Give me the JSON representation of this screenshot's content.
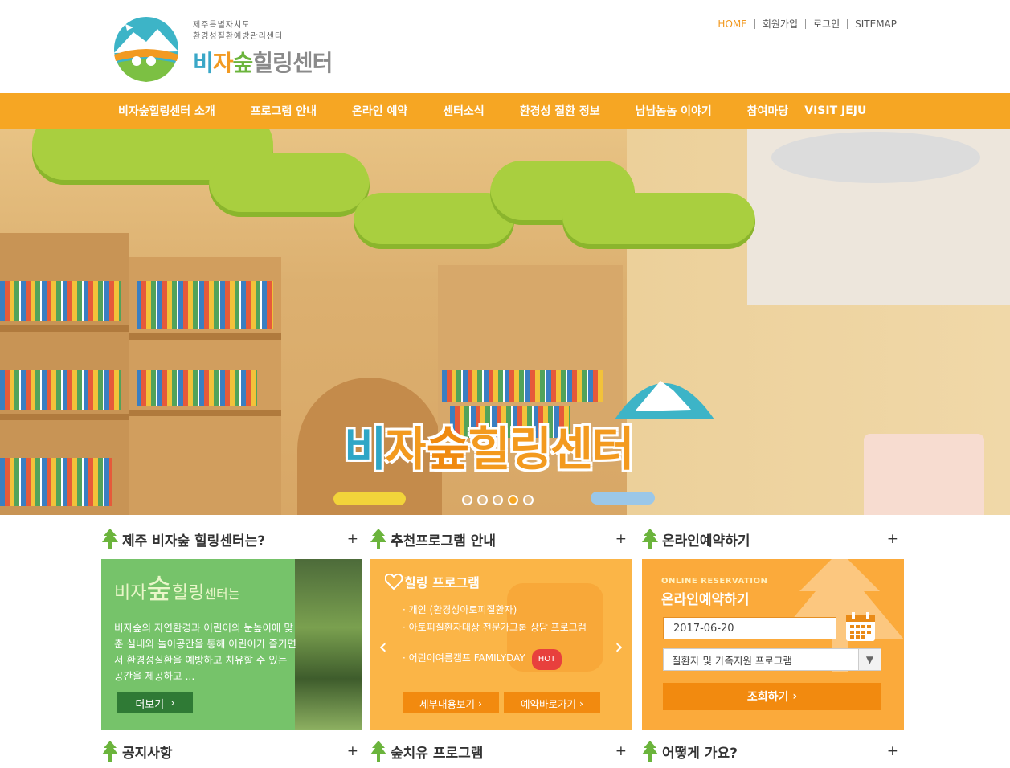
{
  "header": {
    "logo_sub1": "제주특별자치도",
    "logo_sub2": "환경성질환예방관리센터",
    "logo_main_a": "비",
    "logo_main_b": "자",
    "logo_main_c": "숲",
    "logo_main_d": "힐링센터",
    "util": [
      "HOME",
      "회원가입",
      "로그인",
      "SITEMAP"
    ]
  },
  "gnb": [
    "비자숲힐링센터 소개",
    "프로그램 안내",
    "온라인 예약",
    "센터소식",
    "환경성 질환 정보",
    "남남놈놈 이야기",
    "참여마당",
    "VISIT JEJU"
  ],
  "hero": {
    "title_a": "비",
    "title_b": "자",
    "title_c": "숲",
    "title_d": "힐링센터",
    "slide_count": 5,
    "active_slide": 4
  },
  "sections": {
    "about": {
      "title": "제주 비자숲 힐링센터는?",
      "plus": "+"
    },
    "programs": {
      "title": "추천프로그램 안내",
      "plus": "+"
    },
    "reserve": {
      "title": "온라인예약하기",
      "plus": "+"
    },
    "notice": {
      "title": "공지사항",
      "plus": "+"
    },
    "forest": {
      "title": "숲치유 프로그램",
      "plus": "+"
    },
    "howto": {
      "title": "어떻게 가요?",
      "plus": "+"
    }
  },
  "about_box": {
    "title_a": "비자",
    "title_b": "숲",
    "title_c": "힐링",
    "title_d": "센터는",
    "body": "비자숲의 자연환경과 어린이의 눈높이에 맞춘 실내외 놀이공간을 통해 어린이가 즐기면서 환경성질환을 예방하고 치유할 수 있는 공간을 제공하고 ...",
    "more": "더보기"
  },
  "program_box": {
    "title": "힐링 프로그램",
    "items": [
      "· 개인 (환경성아토피질환자)",
      "· 아토피질환자대상 전문가그룹 상담 프로그램",
      "· 어린이여름캠프 FAMILYDAY"
    ],
    "hot": "HOT",
    "prev": "‹",
    "next": "›",
    "btn_detail": "세부내용보기",
    "btn_reserve": "예약바로가기"
  },
  "reserve_box": {
    "en": "ONLINE RESERVATION",
    "title": "온라인예약하기",
    "date": "2017-06-20",
    "program": "질환자 및 가족지원 프로그램",
    "search": "조회하기"
  },
  "colors": {
    "accent": "#f6a623",
    "green": "#76c36a",
    "orange": "#fbb547"
  }
}
